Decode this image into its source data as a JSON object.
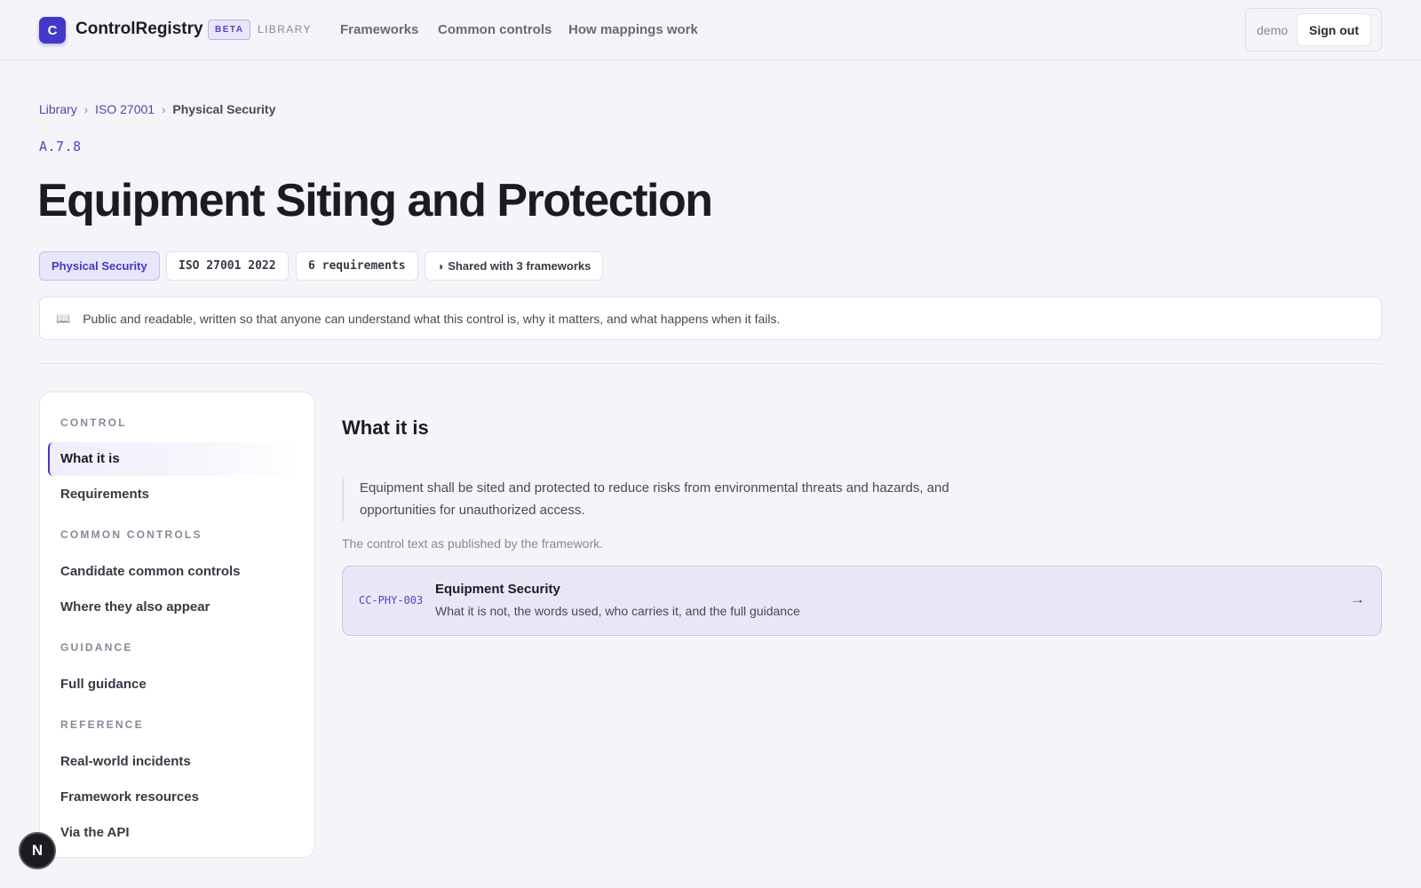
{
  "header": {
    "logo_letter": "C",
    "brand": "ControlRegistry",
    "beta": "BETA",
    "section": "LIBRARY",
    "nav": [
      "Frameworks",
      "Common controls",
      "How mappings work"
    ],
    "user": "demo",
    "sign_out": "Sign out"
  },
  "breadcrumb": {
    "items": [
      "Library",
      "ISO 27001"
    ],
    "separator": "›",
    "current": "Physical Security"
  },
  "control": {
    "code": "A.7.8",
    "title": "Equipment Siting and Protection",
    "chips": {
      "domain": "Physical Security",
      "framework": "ISO 27001 2022",
      "requirements": "6 requirements",
      "shared": "Shared with 3 frameworks",
      "shared_icon": "half-circle-icon"
    }
  },
  "note": {
    "icon": "book-icon",
    "text": "Public and readable, written so that anyone can understand what this control is, why it matters, and what happens when it fails."
  },
  "sidebar": {
    "sections": [
      {
        "title": "CONTROL",
        "items": [
          "What it is",
          "Requirements"
        ]
      },
      {
        "title": "COMMON CONTROLS",
        "items": [
          "Candidate common controls",
          "Where they also appear"
        ]
      },
      {
        "title": "GUIDANCE",
        "items": [
          "Full guidance"
        ]
      },
      {
        "title": "REFERENCE",
        "items": [
          "Real-world incidents",
          "Framework resources",
          "Via the API"
        ]
      }
    ],
    "active_item": "What it is"
  },
  "main": {
    "section_title": "What it is",
    "quote": "Equipment shall be sited and protected to reduce risks from environmental threats and hazards, and opportunities for unauthorized access.",
    "quote_caption": "The control text as published by the framework.",
    "common_control": {
      "code": "CC-PHY-003",
      "title": "Equipment Security",
      "description": "What it is not, the words used, who carries it, and the full guidance",
      "arrow_icon": "arrow-right-icon"
    }
  },
  "fab": {
    "letter": "N"
  },
  "colors": {
    "accent": "#4338ca",
    "background": "#f5f4f9"
  }
}
